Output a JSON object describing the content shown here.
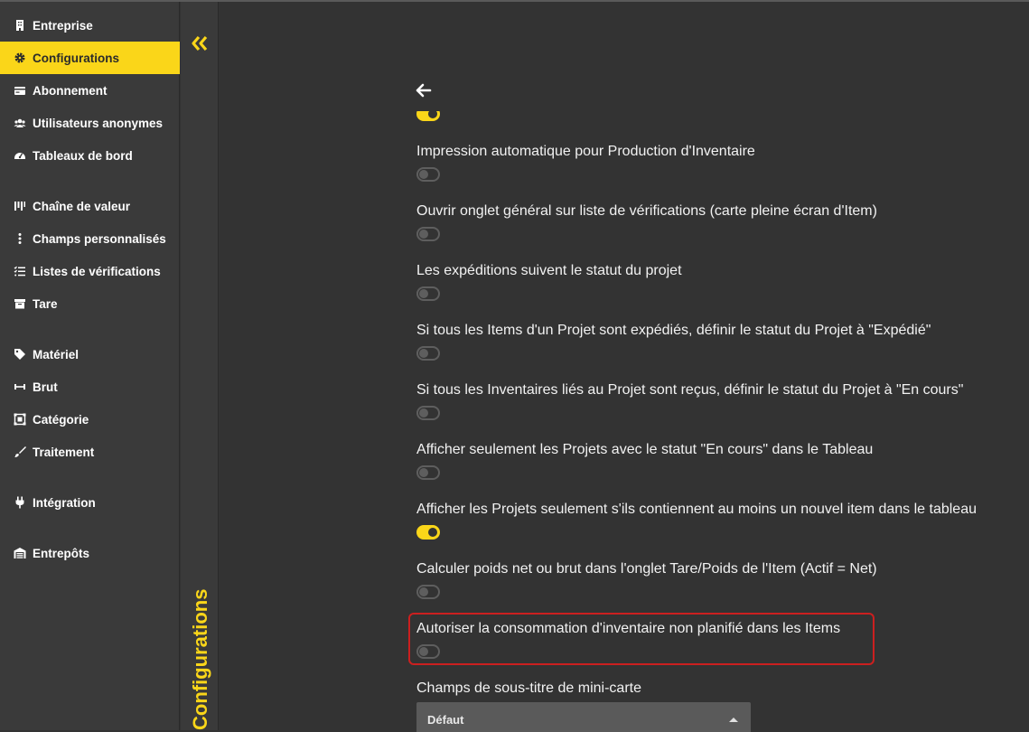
{
  "sidebar": {
    "items": [
      {
        "label": "Entreprise",
        "icon": "building-icon"
      },
      {
        "label": "Configurations",
        "icon": "gear-icon",
        "active": true
      },
      {
        "label": "Abonnement",
        "icon": "credit-card-icon"
      },
      {
        "label": "Utilisateurs anonymes",
        "icon": "users-icon"
      },
      {
        "label": "Tableaux de bord",
        "icon": "gauge-icon"
      },
      {
        "label": "Chaîne de valeur",
        "icon": "value-chain-icon"
      },
      {
        "label": "Champs personnalisés",
        "icon": "vertical-dots-icon"
      },
      {
        "label": "Listes de vérifications",
        "icon": "checklist-icon"
      },
      {
        "label": "Tare",
        "icon": "archive-box-icon"
      },
      {
        "label": "Matériel",
        "icon": "tag-icon"
      },
      {
        "label": "Brut",
        "icon": "ruler-horizontal-icon"
      },
      {
        "label": "Catégorie",
        "icon": "object-group-icon"
      },
      {
        "label": "Traitement",
        "icon": "brush-icon"
      },
      {
        "label": "Intégration",
        "icon": "plug-icon"
      },
      {
        "label": "Entrepôts",
        "icon": "warehouse-icon"
      }
    ]
  },
  "panel": {
    "title": "Configurations",
    "collapse_icon": "double-chevron-left-icon"
  },
  "colors": {
    "accent": "#fad619",
    "background": "#333333",
    "sidebar": "#3a3a3a",
    "highlight": "#cc1f1f"
  },
  "main": {
    "back_icon": "arrow-left-icon",
    "settings": [
      {
        "label": "",
        "on": true
      },
      {
        "label": "Impression automatique pour Production d'Inventaire",
        "on": false
      },
      {
        "label": "Ouvrir onglet général sur liste de vérifications (carte pleine écran d'Item)",
        "on": false
      },
      {
        "label": "Les expéditions suivent le statut du projet",
        "on": false
      },
      {
        "label": "Si tous les Items d'un Projet sont expédiés, définir le statut du Projet à \"Expédié\"",
        "on": false
      },
      {
        "label": "Si tous les Inventaires liés au Projet sont reçus, définir le statut du Projet à \"En cours\"",
        "on": false
      },
      {
        "label": "Afficher seulement les Projets avec le statut \"En cours\" dans le Tableau",
        "on": false
      },
      {
        "label": "Afficher les Projets seulement s'ils contiennent au moins un nouvel item dans le tableau",
        "on": true
      },
      {
        "label": "Calculer poids net ou brut dans l'onglet Tare/Poids de l'Item (Actif = Net)",
        "on": false
      },
      {
        "label": "Autoriser la consommation d'inventaire non planifié dans les Items",
        "on": false,
        "highlighted": true
      }
    ],
    "subtitle_field": {
      "label": "Champs de sous-titre de mini-carte",
      "selected": "Défaut"
    }
  }
}
